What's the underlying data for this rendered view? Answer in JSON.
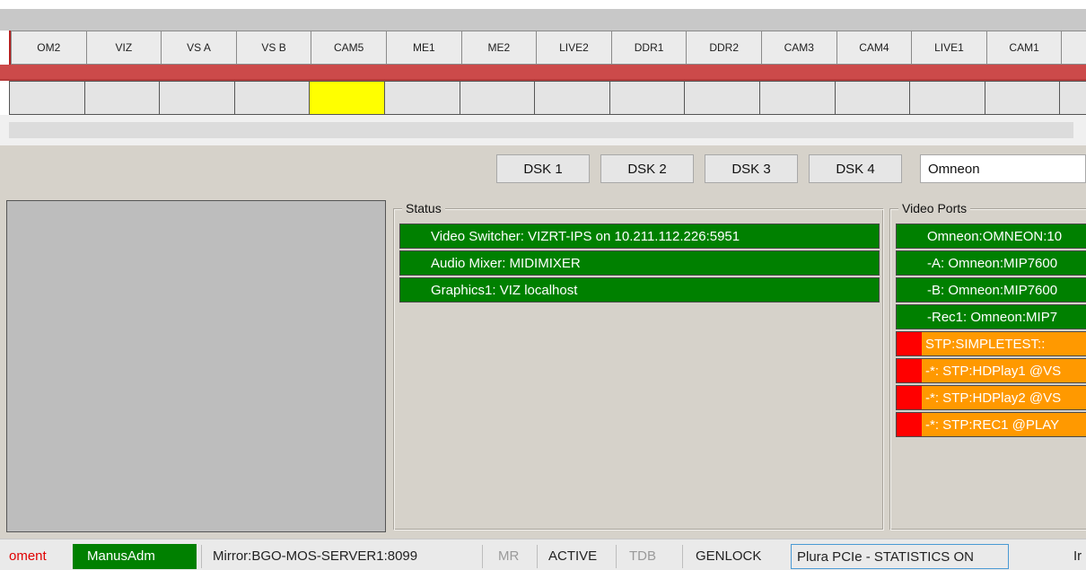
{
  "sources": [
    "OM2",
    "VIZ",
    "VS A",
    "VS B",
    "CAM5",
    "ME1",
    "ME2",
    "LIVE2",
    "DDR1",
    "DDR2",
    "CAM3",
    "CAM4",
    "LIVE1",
    "CAM1",
    "C"
  ],
  "tally_active_index": 4,
  "dsk_buttons": [
    "DSK 1",
    "DSK 2",
    "DSK 3",
    "DSK 4"
  ],
  "server_select": "Omneon",
  "status": {
    "title": "Status",
    "rows": [
      "Video Switcher: VIZRT-IPS on 10.211.112.226:5951",
      "Audio Mixer: MIDIMIXER",
      "Graphics1: VIZ localhost"
    ]
  },
  "video_ports": {
    "title": "Video Ports",
    "rows": [
      {
        "text": "Omneon:OMNEON:10",
        "state": "ok"
      },
      {
        "text": "-A: Omneon:MIP7600",
        "state": "ok"
      },
      {
        "text": "-B: Omneon:MIP7600",
        "state": "ok"
      },
      {
        "text": "-Rec1: Omneon:MIP7",
        "state": "ok"
      },
      {
        "text": "STP:SIMPLETEST::",
        "state": "error"
      },
      {
        "text": "-*: STP:HDPlay1 @VS",
        "state": "error"
      },
      {
        "text": "-*: STP:HDPlay2 @VS",
        "state": "error"
      },
      {
        "text": "-*: STP:REC1 @PLAY",
        "state": "error"
      }
    ]
  },
  "status_bar": {
    "cut_left": "oment",
    "user": "ManusAdm",
    "mirror": "Mirror:BGO-MOS-SERVER1:8099",
    "mr": "MR",
    "active": "ACTIVE",
    "tdb": "TDB",
    "genlock": "GENLOCK",
    "card": "Plura PCIe - STATISTICS ON",
    "cut_right": "Ir"
  },
  "colors": {
    "ok": "#008000",
    "warning": "#ff9900",
    "error": "#ff0000",
    "tally_on": "#ffff00",
    "program_bar": "#cc4a4a"
  }
}
